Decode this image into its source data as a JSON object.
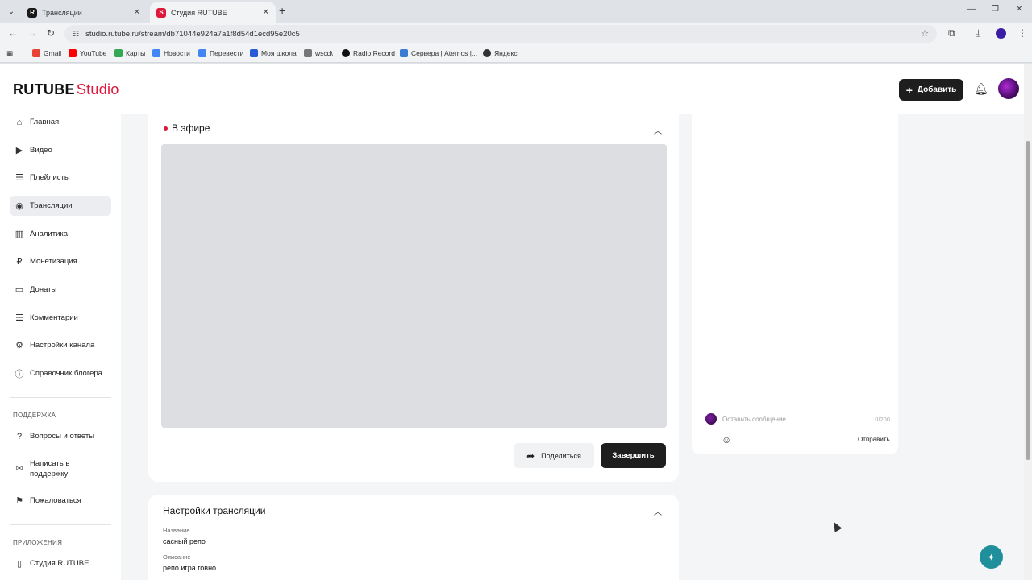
{
  "browser": {
    "tabs": [
      {
        "title": "Трансляции",
        "active": false
      },
      {
        "title": "Студия RUTUBE",
        "active": true
      }
    ],
    "url": "studio.rutube.ru/stream/db71044e924a7a1f8d54d1ecd95e20c5",
    "bookmarks": [
      "Gmail",
      "YouTube",
      "Карты",
      "Новости",
      "Перевести",
      "Моя школа",
      "wscd\\",
      "Radio Record",
      "Сервера | Aternos |...",
      "Яндекс"
    ]
  },
  "header": {
    "logo_main": "RUTUBE",
    "logo_sub": "Studio",
    "add_label": "Добавить"
  },
  "sidebar": {
    "items": [
      "Главная",
      "Видео",
      "Плейлисты",
      "Трансляции",
      "Аналитика",
      "Монетизация",
      "Донаты",
      "Комментарии",
      "Настройки канала",
      "Справочник блогера"
    ],
    "support_header": "ПОДДЕРЖКА",
    "support_items": [
      "Вопросы и ответы",
      "Написать в поддержку",
      "Пожаловаться"
    ],
    "apps_header": "ПРИЛОЖЕНИЯ",
    "apps_items": [
      "Студия RUTUBE"
    ]
  },
  "live": {
    "title": "В эфире",
    "share_label": "Поделиться",
    "end_label": "Завершить"
  },
  "chat": {
    "placeholder": "Оставить сообщение...",
    "counter": "0/200",
    "send_label": "Отправить"
  },
  "settings": {
    "title": "Настройки трансляции",
    "name_label": "Название",
    "name_value": "сасный репо",
    "desc_label": "Описание",
    "desc_value": "репо игра говно"
  },
  "colors": {
    "accent": "#e0173b",
    "dark_button": "#1e1e1e",
    "help_fab": "#1f8f9c"
  }
}
